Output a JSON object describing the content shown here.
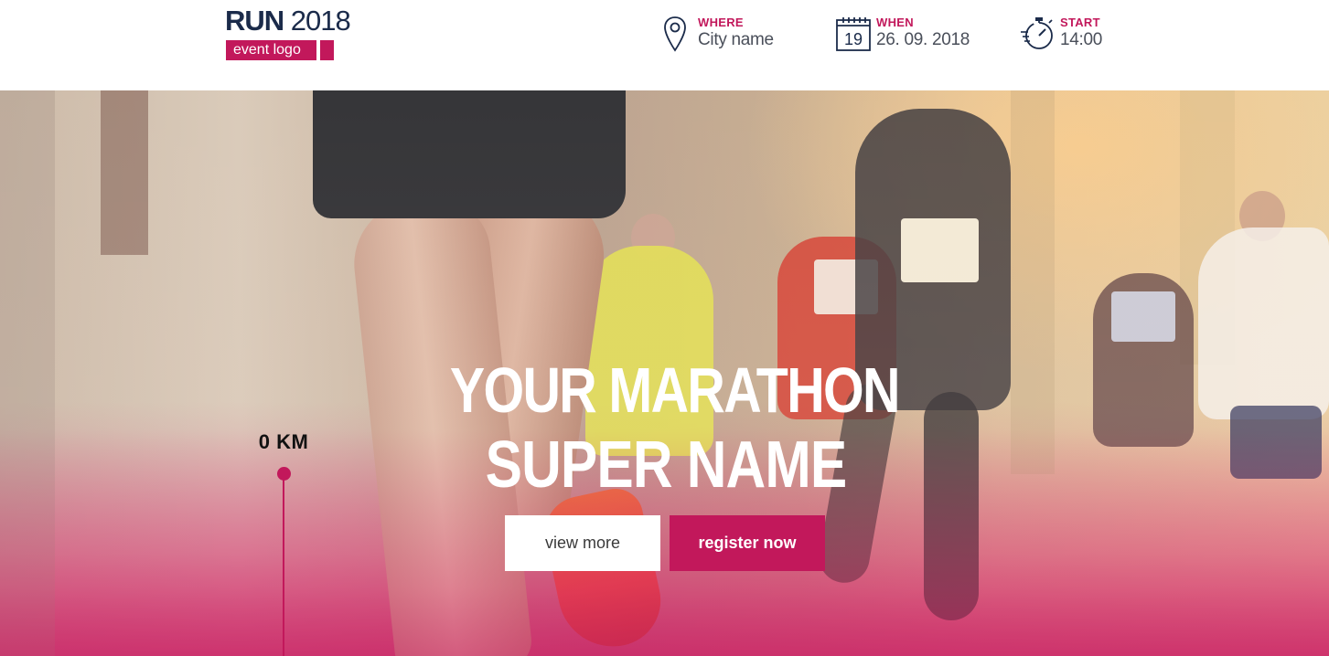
{
  "header": {
    "logo": {
      "title_bold": "RUN",
      "title_year": "2018",
      "tagline": "event logo"
    },
    "where": {
      "label": "WHERE",
      "value": "City name",
      "icon": "map-pin-icon"
    },
    "when": {
      "label": "WHEN",
      "value": "26. 09. 2018",
      "icon": "calendar-icon",
      "calendar_day": "19"
    },
    "start": {
      "label": "START",
      "value": "14:00",
      "icon": "stopwatch-icon"
    }
  },
  "hero": {
    "title_line1": "YOUR MARATHON",
    "title_line2": "SUPER NAME",
    "view_more_label": "view more",
    "register_label": "register now",
    "distance_marker": "0 KM"
  },
  "colors": {
    "accent": "#c2185b",
    "navy": "#1b2b4a",
    "white": "#ffffff"
  }
}
